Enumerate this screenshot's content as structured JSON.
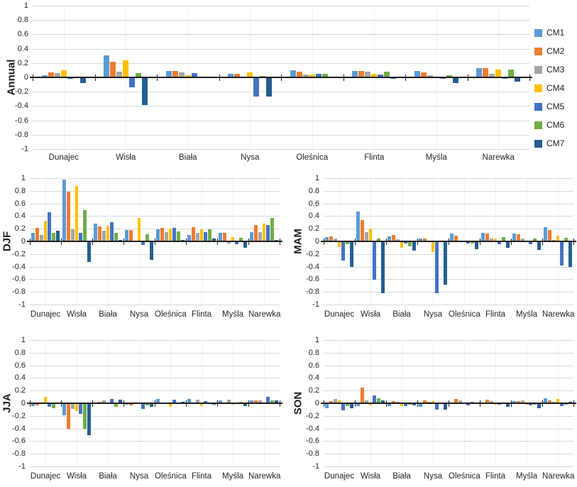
{
  "figure": {
    "background": "#FFFFFF"
  },
  "palette": {
    "CM1": "#5B9BD5",
    "CM2": "#ED7D31",
    "CM3": "#A5A5A5",
    "CM4": "#FFC000",
    "CM5": "#4472C4",
    "CM6": "#70AD47",
    "CM7": "#255E91"
  },
  "axis": {
    "grid_color": "#D9D9D9",
    "axis_color": "#1F1F1F",
    "tick_labels": [
      "1",
      "0.8",
      "0.6",
      "0.4",
      "0.2",
      "0",
      "-0.2",
      "-0.4",
      "-0.6",
      "-0.8",
      "-1"
    ]
  },
  "legend": {
    "position": "right-of-annual-chart",
    "entries": [
      "CM1",
      "CM2",
      "CM3",
      "CM4",
      "CM5",
      "CM6",
      "CM7"
    ]
  },
  "chart_data": [
    {
      "id": "annual",
      "type": "bar",
      "ylabel": "Annual",
      "ylim": [
        -1,
        1
      ],
      "grid": true,
      "categories": [
        "Dunajec",
        "Wisła",
        "Biała",
        "Nysa",
        "Oleśnica",
        "Flinta",
        "Myśla",
        "Narewka"
      ],
      "series": [
        {
          "name": "CM1",
          "values": [
            0.03,
            0.31,
            0.09,
            0.05,
            0.1,
            0.09,
            0.09,
            0.13
          ]
        },
        {
          "name": "CM2",
          "values": [
            0.07,
            0.22,
            0.09,
            0.05,
            0.08,
            0.09,
            0.07,
            0.13
          ]
        },
        {
          "name": "CM3",
          "values": [
            0.06,
            0.08,
            0.07,
            0.0,
            0.04,
            0.08,
            0.03,
            0.05
          ]
        },
        {
          "name": "CM4",
          "values": [
            0.1,
            0.24,
            0.03,
            0.07,
            0.04,
            0.05,
            0.01,
            0.11
          ]
        },
        {
          "name": "CM5",
          "values": [
            -0.02,
            -0.14,
            0.06,
            -0.27,
            0.05,
            0.04,
            -0.02,
            -0.02
          ]
        },
        {
          "name": "CM6",
          "values": [
            0.01,
            0.06,
            0.01,
            0.02,
            0.05,
            0.08,
            0.03,
            0.11
          ]
        },
        {
          "name": "CM7",
          "values": [
            -0.08,
            -0.39,
            0.0,
            -0.27,
            0.0,
            -0.02,
            -0.08,
            -0.06
          ]
        }
      ]
    },
    {
      "id": "djf",
      "type": "bar",
      "ylabel": "DJF",
      "ylim": [
        -1,
        1
      ],
      "grid": true,
      "categories": [
        "Dunajec",
        "Wisła",
        "Biała",
        "Nysa",
        "Oleśnica",
        "Flinta",
        "Myśla",
        "Narewka"
      ],
      "series": [
        {
          "name": "CM1",
          "values": [
            0.14,
            0.98,
            0.28,
            0.18,
            0.19,
            0.1,
            0.14,
            0.15
          ]
        },
        {
          "name": "CM2",
          "values": [
            0.21,
            0.79,
            0.24,
            0.18,
            0.21,
            0.22,
            0.14,
            0.26
          ]
        },
        {
          "name": "CM3",
          "values": [
            0.1,
            0.19,
            0.17,
            -0.01,
            0.15,
            0.13,
            -0.03,
            0.15
          ]
        },
        {
          "name": "CM4",
          "values": [
            0.33,
            0.88,
            0.25,
            0.37,
            0.2,
            0.19,
            0.07,
            0.28
          ]
        },
        {
          "name": "CM5",
          "values": [
            0.46,
            0.13,
            0.3,
            -0.06,
            0.21,
            0.15,
            -0.04,
            0.26
          ]
        },
        {
          "name": "CM6",
          "values": [
            0.14,
            0.5,
            0.14,
            0.11,
            0.16,
            0.19,
            0.06,
            0.37
          ]
        },
        {
          "name": "CM7",
          "values": [
            0.17,
            -0.33,
            0.02,
            -0.29,
            0.02,
            0.04,
            -0.1,
            0.02
          ]
        }
      ]
    },
    {
      "id": "mam",
      "type": "bar",
      "ylabel": "MAM",
      "ylim": [
        -1,
        1
      ],
      "grid": true,
      "categories": [
        "Dunajec",
        "Wisła",
        "Biała",
        "Nysa",
        "Oleśnica",
        "Flinta",
        "Myśla",
        "Narewka"
      ],
      "series": [
        {
          "name": "CM1",
          "values": [
            0.07,
            0.47,
            0.08,
            0.04,
            0.12,
            0.13,
            0.12,
            0.22
          ]
        },
        {
          "name": "CM2",
          "values": [
            0.08,
            0.34,
            0.1,
            0.04,
            0.09,
            0.12,
            0.11,
            0.18
          ]
        },
        {
          "name": "CM3",
          "values": [
            0.04,
            0.15,
            0.03,
            0.0,
            0.0,
            0.05,
            0.05,
            0.02
          ]
        },
        {
          "name": "CM4",
          "values": [
            -0.09,
            0.2,
            -0.1,
            -0.17,
            0.0,
            0.05,
            0.0,
            0.09
          ]
        },
        {
          "name": "CM5",
          "values": [
            -0.3,
            -0.61,
            -0.03,
            -0.82,
            -0.03,
            -0.05,
            -0.04,
            -0.38
          ]
        },
        {
          "name": "CM6",
          "values": [
            -0.05,
            0.05,
            -0.08,
            0.0,
            -0.03,
            0.07,
            0.05,
            0.06
          ]
        },
        {
          "name": "CM7",
          "values": [
            -0.41,
            -0.82,
            -0.15,
            -0.68,
            -0.12,
            -0.1,
            -0.13,
            -0.4
          ]
        }
      ]
    },
    {
      "id": "jja",
      "type": "bar",
      "ylabel": "JJA",
      "ylim": [
        -1,
        1
      ],
      "grid": true,
      "categories": [
        "Dunajec",
        "Wisła",
        "Biała",
        "Nysa",
        "Oleśnica",
        "Flinta",
        "Myśla",
        "Narewka"
      ],
      "series": [
        {
          "name": "CM1",
          "values": [
            -0.05,
            -0.19,
            0.01,
            -0.02,
            0.07,
            0.07,
            0.05,
            0.05
          ]
        },
        {
          "name": "CM2",
          "values": [
            -0.03,
            -0.41,
            0.02,
            -0.03,
            0.01,
            -0.01,
            0.01,
            0.05
          ]
        },
        {
          "name": "CM3",
          "values": [
            -0.01,
            -0.09,
            0.05,
            0.01,
            0.01,
            0.06,
            0.06,
            0.05
          ]
        },
        {
          "name": "CM4",
          "values": [
            0.1,
            -0.12,
            0.0,
            0.0,
            -0.06,
            -0.05,
            -0.02,
            0.01
          ]
        },
        {
          "name": "CM5",
          "values": [
            -0.06,
            -0.17,
            0.07,
            -0.09,
            0.06,
            0.03,
            0.01,
            0.1
          ]
        },
        {
          "name": "CM6",
          "values": [
            -0.08,
            -0.4,
            -0.06,
            -0.03,
            0.01,
            0.0,
            0.02,
            0.04
          ]
        },
        {
          "name": "CM7",
          "values": [
            -0.01,
            -0.5,
            0.06,
            -0.06,
            0.02,
            -0.02,
            -0.04,
            0.05
          ]
        }
      ]
    },
    {
      "id": "son",
      "type": "bar",
      "ylabel": "SON",
      "ylim": [
        -1,
        1
      ],
      "grid": true,
      "categories": [
        "Dunajec",
        "Wisła",
        "Biała",
        "Nysa",
        "Oleśnica",
        "Flinta",
        "Myśla",
        "Narewka"
      ],
      "series": [
        {
          "name": "CM1",
          "values": [
            -0.08,
            -0.04,
            -0.05,
            -0.06,
            -0.01,
            -0.01,
            0.03,
            0.08
          ]
        },
        {
          "name": "CM2",
          "values": [
            0.03,
            0.25,
            0.03,
            0.04,
            0.07,
            0.06,
            0.03,
            0.04
          ]
        },
        {
          "name": "CM3",
          "values": [
            0.07,
            0.04,
            0.02,
            0.02,
            0.04,
            0.03,
            0.04,
            0.02
          ]
        },
        {
          "name": "CM4",
          "values": [
            0.04,
            -0.03,
            -0.04,
            0.03,
            0.01,
            -0.02,
            -0.02,
            0.07
          ]
        },
        {
          "name": "CM5",
          "values": [
            -0.11,
            0.12,
            -0.05,
            -0.1,
            -0.03,
            -0.02,
            -0.03,
            -0.05
          ]
        },
        {
          "name": "CM6",
          "values": [
            -0.05,
            0.08,
            -0.02,
            -0.01,
            0.02,
            0.01,
            -0.02,
            -0.02
          ]
        },
        {
          "name": "CM7",
          "values": [
            -0.08,
            0.05,
            -0.03,
            -0.1,
            -0.01,
            -0.06,
            -0.08,
            0.02
          ]
        }
      ]
    }
  ]
}
